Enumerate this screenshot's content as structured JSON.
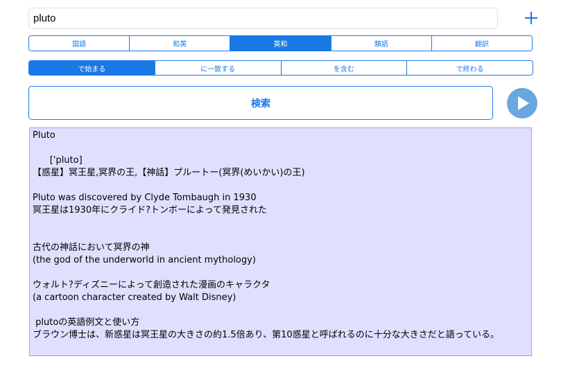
{
  "search": {
    "value": "pluto"
  },
  "add_button": "+",
  "dict_tabs": [
    {
      "label": "国語",
      "active": false
    },
    {
      "label": "和英",
      "active": false
    },
    {
      "label": "英和",
      "active": true
    },
    {
      "label": "類語",
      "active": false
    },
    {
      "label": "翻訳",
      "active": false
    }
  ],
  "match_tabs": [
    {
      "label": "で始まる",
      "active": true
    },
    {
      "label": "に一致する",
      "active": false
    },
    {
      "label": "を含む",
      "active": false
    },
    {
      "label": "で終わる",
      "active": false
    }
  ],
  "search_button": "検索",
  "result": {
    "headword": "Pluto",
    "pronunciation": "      ['pluto]",
    "definition": "【惑星】冥王星,冥界の王,【神話】プルートー(冥界(めいかい)の王)",
    "example_en": "Pluto was discovered by Clyde Tombaugh in 1930",
    "example_ja": "冥王星は1930年にクライド?トンボーによって発見された",
    "sense1_ja": "古代の神話において冥界の神",
    "sense1_en": "(the god of the underworld in ancient mythology)",
    "sense2_ja": "ウォルト?ディズニーによって創造された漫画のキャラクタ",
    "sense2_en": "(a cartoon character created by Walt Disney)",
    "usage_title": " plutoの英語例文と使い方",
    "usage_text": "ブラウン博士は、新惑星は冥王星の大きさの約1.5倍あり、第10惑星と呼ばれるのに十分な大きさだと語っている。"
  },
  "colors": {
    "accent": "#1a78e6",
    "result_bg": "#dfe0fe",
    "play": "#6aa7e1"
  }
}
